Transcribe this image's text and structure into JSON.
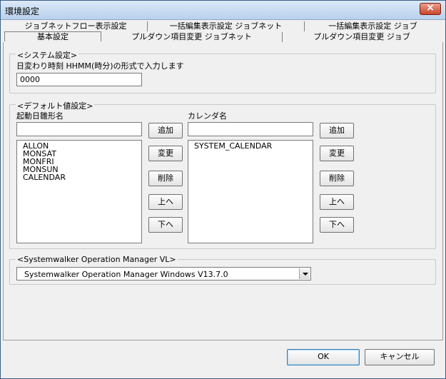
{
  "window": {
    "title": "環境設定"
  },
  "tabs": {
    "row1": [
      "ジョブネットフロー表示設定",
      "一括編集表示設定 ジョブネット",
      "一括編集表示設定 ジョブ"
    ],
    "row2": [
      "基本設定",
      "プルダウン項目変更 ジョブネット",
      "プルダウン項目変更 ジョブ"
    ]
  },
  "system_settings": {
    "legend": "<システム設定>",
    "day_change_label": "日変わり時刻  HHMM(時分)の形式で入力します",
    "day_change_value": "0000"
  },
  "default_settings": {
    "legend": "<デフォルト値設定>",
    "start_day_pattern_label": "起動日雛形名",
    "calendar_label": "カレンダ名",
    "start_day_patterns": [
      "ALLON",
      "MONSAT",
      "MONFRI",
      "MONSUN",
      "CALENDAR"
    ],
    "calendars": [
      "SYSTEM_CALENDAR"
    ],
    "buttons": {
      "add": "追加",
      "change": "変更",
      "delete": "削除",
      "up": "上へ",
      "down": "下へ"
    }
  },
  "operation_manager": {
    "legend": "<Systemwalker Operation Manager VL>",
    "selected": "Systemwalker Operation Manager Windows V13.7.0"
  },
  "footer": {
    "ok": "OK",
    "cancel": "キャンセル"
  }
}
